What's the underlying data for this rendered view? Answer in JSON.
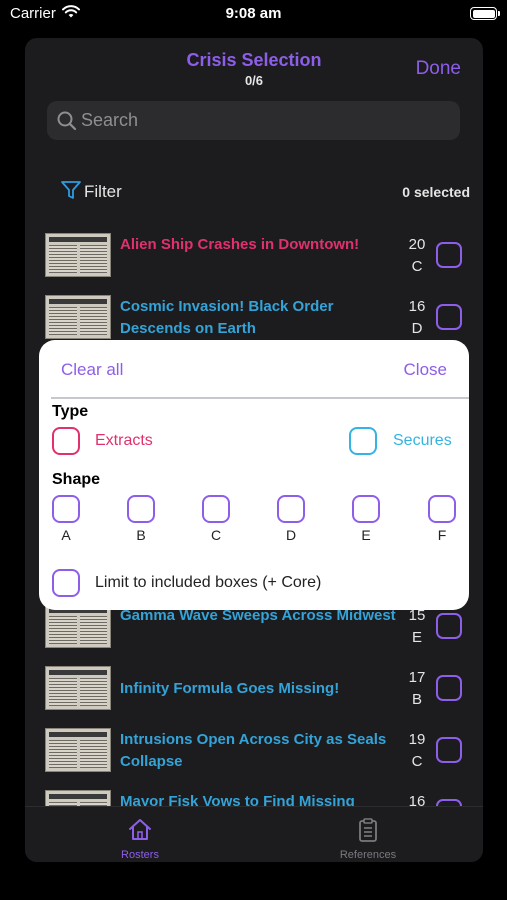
{
  "status_bar": {
    "carrier": "Carrier",
    "time": "9:08 am"
  },
  "header": {
    "title": "Crisis Selection",
    "counter": "0/6",
    "done_label": "Done"
  },
  "search": {
    "placeholder": "Search",
    "value": ""
  },
  "filter_bar": {
    "filter_label": "Filter",
    "selected_count": "0 selected"
  },
  "crisis_list": [
    {
      "title": "Alien Ship Crashes in Downtown!",
      "number": "20",
      "letter": "C",
      "color": "pink"
    },
    {
      "title": "Cosmic Invasion! Black Order Descends on Earth",
      "number": "16",
      "letter": "D",
      "color": "blue"
    },
    {
      "title": "Gamma Wave Sweeps Across Midwest",
      "number": "15",
      "letter": "E",
      "color": "blue"
    },
    {
      "title": "Infinity Formula Goes Missing!",
      "number": "17",
      "letter": "B",
      "color": "blue"
    },
    {
      "title": "Intrusions Open Across City as Seals Collapse",
      "number": "19",
      "letter": "C",
      "color": "blue"
    },
    {
      "title": "Mayor Fisk Vows to Find Missing",
      "number": "16",
      "letter": "",
      "color": "blue"
    }
  ],
  "filter_popover": {
    "clear_all_label": "Clear all",
    "close_label": "Close",
    "type_heading": "Type",
    "types": [
      {
        "label": "Extracts",
        "color": "#e0316e"
      },
      {
        "label": "Secures",
        "color": "#34b3e4"
      }
    ],
    "shape_heading": "Shape",
    "shapes": [
      "A",
      "B",
      "C",
      "D",
      "E",
      "F"
    ],
    "limit_label": "Limit to included boxes (+ Core)"
  },
  "tab_bar": {
    "tabs": [
      {
        "label": "Rosters",
        "icon": "house-icon",
        "active": true
      },
      {
        "label": "References",
        "icon": "clipboard-icon",
        "active": false
      }
    ]
  },
  "colors": {
    "accent": "#8d5ee8",
    "extracts": "#e0316e",
    "secures": "#34b3e4",
    "background": "#1c1c1e"
  }
}
